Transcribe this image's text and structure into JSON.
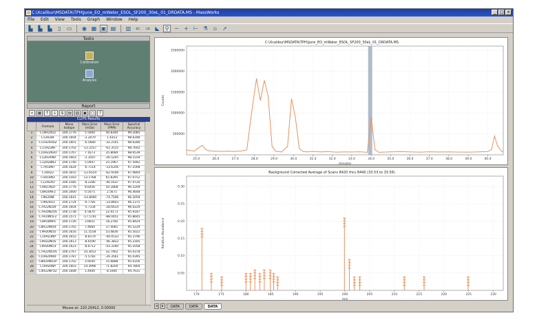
{
  "window": {
    "title": "C:\\Xcalibur\\MSDATA\\TPH\\June_EO_mWater_ESOL_SF200_30eL_01_DRDATA.MS - MassWorks",
    "buttons": [
      "_",
      "□",
      "×"
    ]
  },
  "menu": [
    "File",
    "Edit",
    "View",
    "Tools",
    "Graph",
    "Window",
    "Help"
  ],
  "toolbar_icons": [
    "new-icon",
    "open-icon",
    "save-icon",
    "copy-icon",
    "print-icon",
    "chart-icon",
    "table-icon",
    "report-icon",
    "settings-icon",
    "left-arrow-icon",
    "right-arrow-icon",
    "peak-icon",
    "zoom-icon",
    "baseline-icon",
    "crosshair-icon",
    "marker-icon",
    "calibrate-icon",
    "help-icon"
  ],
  "tasks": {
    "header": "Tasks",
    "items": [
      {
        "label": "Calibration",
        "icon": "calibration-icon"
      },
      {
        "label": "Analysis",
        "icon": "analysis-icon"
      }
    ]
  },
  "report": {
    "header": "Report",
    "table_title": "CLIPS Results",
    "columns": [
      "",
      "Formula",
      "Mono Isotope",
      "Mass Error (mDa)",
      "Mass Error (PPM)",
      "Spectral Accuracy"
    ],
    "rows": [
      [
        "1",
        "C10H24O2",
        "200.1776",
        "5.5000",
        "40.8340",
        "99.2085"
      ],
      [
        "2",
        "C12H28F",
        "200.1604",
        "-2.2070",
        "1.4353",
        "98.6348"
      ],
      [
        "3",
        "C11H24OS2",
        "200.1601",
        "-6.5660",
        "-32.2101",
        "98.6280"
      ],
      [
        "4",
        "C11H22NF",
        "200.1702",
        "-12.2557",
        "-61.3515",
        "98.7602"
      ],
      [
        "5",
        "C10H22N3O",
        "200.1767",
        "7.1673",
        "35.8084",
        "98.6539"
      ],
      [
        "6",
        "C12H24NO",
        "200.1603",
        "-2.3507",
        "-26.5245",
        "98.1559"
      ],
      [
        "7",
        "C12H28N3",
        "200.1740",
        "5.0447",
        "25.1967",
        "97.5992"
      ],
      [
        "8",
        "C7H18N7",
        "200.1624",
        "-6.7114",
        "-33.6356",
        "97.2568"
      ],
      [
        "9",
        "C10H22",
        "200.1655",
        "-12.6554",
        "-62.9106",
        "97.0804"
      ],
      [
        "10",
        "C5H18N3",
        "200.1593",
        "13.1768",
        "65.8395",
        "97.0752"
      ],
      [
        "11",
        "C12H24O",
        "200.1585",
        "-8.2285",
        "-40.1637",
        "97.0720"
      ],
      [
        "12",
        "C9H21N2F",
        "200.1776",
        "8.6456",
        "50.1868",
        "96.5209"
      ],
      [
        "13",
        "C8H20NF2",
        "200.1600",
        "0.5075",
        "2.5671",
        "96.4648"
      ],
      [
        "14",
        "C9H20NF",
        "200.1641",
        "-14.8000",
        "-74.7506",
        "96.2059"
      ],
      [
        "15",
        "C9H24O3",
        "200.1724",
        "-6.7781",
        "-33.8603",
        "96.1375"
      ],
      [
        "16",
        "C7H22N3OF",
        "200.1604",
        "-5.7334",
        "-28.6614",
        "96.0229"
      ],
      [
        "17",
        "C7H20N2OS",
        "200.1738",
        "4.5870",
        "22.9173",
        "95.9187"
      ],
      [
        "18",
        "C7H19N5F2",
        "200.1571",
        "-17.5701",
        "-88.0451",
        "95.8645"
      ],
      [
        "19",
        "C8H18NF6",
        "200.1726",
        "3.6651",
        "18.2782",
        "95.8424"
      ],
      [
        "20",
        "C8H22N4OF",
        "200.1765",
        "7.4660",
        "37.4081",
        "95.5229"
      ],
      [
        "21",
        "C9H20N5O",
        "200.1616",
        "11.5558",
        "53.4830",
        "95.5022"
      ],
      [
        "22",
        "C10H23NP",
        "200.1652",
        "-8.8179",
        "-44.0533",
        "95.3796"
      ],
      [
        "23",
        "C9H22NOS",
        "200.1613",
        "-8.6590",
        "-46.3833",
        "95.2185"
      ],
      [
        "24",
        "C9H20NO3",
        "200.1623",
        "-8.6712",
        "-43.3160",
        "95.1058"
      ],
      [
        "25",
        "C7H22N5OS",
        "200.1767",
        "10.3052",
        "32.7462",
        "95.0378"
      ],
      [
        "26",
        "C10H24NOF",
        "200.1787",
        "-5.5781",
        "-26.3561",
        "95.0395"
      ],
      [
        "27",
        "C8H20NO2P",
        "200.1702",
        "3.9540",
        "15.6888",
        "95.0356"
      ],
      [
        "28",
        "C10H20NP",
        "200.1603",
        "14.3996",
        "71.8204",
        "94.7804"
      ],
      [
        "29",
        "C4H22NFO2",
        "200.1608",
        "1.4400",
        "8.1000",
        "94.7631"
      ]
    ],
    "status": "Mouse at: 220.20412, 0.00000"
  },
  "tabs": [
    "DATA",
    "DATA",
    "DATA"
  ],
  "chart_data": [
    {
      "type": "line",
      "title": "C:\\Xcalibur\\MSDATA\\TPH\\June_EO_mWater_ESOL_SF200_30eL_01_DRDATA.MS",
      "xlabel": "minutes",
      "ylabel": "Counts",
      "xlim": [
        24.5,
        40.8
      ],
      "ylim": [
        0,
        2600000
      ],
      "xticks": [
        "25.0",
        "26.0",
        "27.0",
        "28.0",
        "29.0",
        "30.0",
        "31.0",
        "32.0",
        "33.0",
        "34.0",
        "35.0",
        "36.0",
        "37.0",
        "38.0",
        "39.0",
        "40.0"
      ],
      "yticks": [
        "2500000",
        "2000000",
        "1500000",
        "1000000",
        "500000"
      ],
      "grid": true,
      "series": [
        {
          "color": "#e9905c",
          "x": [
            24.5,
            24.7,
            24.9,
            25.1,
            25.3,
            25.5,
            25.7,
            26.0,
            26.3,
            26.6,
            27.0,
            27.3,
            27.6,
            27.9,
            28.1,
            28.3,
            28.5,
            28.7,
            28.9,
            29.1,
            29.4,
            29.7,
            29.9,
            30.1,
            30.3,
            30.5,
            30.7,
            31.0,
            31.4,
            31.8,
            32.2,
            32.6,
            33.0,
            33.4,
            33.8,
            34.0,
            34.2,
            34.4,
            34.6,
            35.0,
            35.5,
            36.0,
            36.5,
            37.0,
            37.5,
            38.0,
            38.5,
            39.0,
            39.5,
            40.0,
            40.2,
            40.35,
            40.5,
            40.7,
            40.8
          ],
          "y": [
            120000,
            100000,
            90000,
            160000,
            230000,
            120000,
            90000,
            85000,
            80000,
            85000,
            80000,
            90000,
            120000,
            1200000,
            1820000,
            1300000,
            1780000,
            1400000,
            200000,
            80000,
            70000,
            200000,
            1340000,
            900000,
            150000,
            80000,
            70000,
            80000,
            70000,
            75000,
            65000,
            70000,
            68000,
            72000,
            60000,
            900000,
            120000,
            60000,
            65000,
            70000,
            75000,
            70000,
            65000,
            72000,
            68000,
            70000,
            66000,
            65000,
            70000,
            75000,
            130000,
            450000,
            220000,
            90000,
            70000
          ]
        }
      ],
      "highlight_x": 33.95
    },
    {
      "type": "bar",
      "title": "Background Corrected Average of Scans 8420 thru 8440 (33.53 to 33.56)",
      "xlabel": "m/z",
      "ylabel": "Relative Abundance",
      "xlim": [
        168,
        232
      ],
      "ylim": [
        0,
        0.33
      ],
      "xticks": [
        "170",
        "175",
        "180",
        "185",
        "190",
        "195",
        "200",
        "205",
        "210",
        "215",
        "220",
        "225",
        "230"
      ],
      "yticks": [
        "0.30",
        "0.25",
        "0.20",
        "0.15",
        "0.10",
        "0.05"
      ],
      "grid": true,
      "x": [
        171.1,
        173.0,
        175.1,
        180.0,
        180.9,
        181.8,
        182.8,
        183.7,
        184.9,
        185.6,
        186.4,
        199.9,
        200.9,
        201.9,
        203.0,
        212.0,
        216.0,
        224.9
      ],
      "values": [
        0.18,
        0.05,
        0.04,
        0.05,
        0.05,
        0.06,
        0.05,
        0.06,
        0.06,
        0.05,
        0.04,
        0.21,
        0.09,
        0.04,
        0.04,
        0.04,
        0.04,
        0.04
      ]
    }
  ]
}
